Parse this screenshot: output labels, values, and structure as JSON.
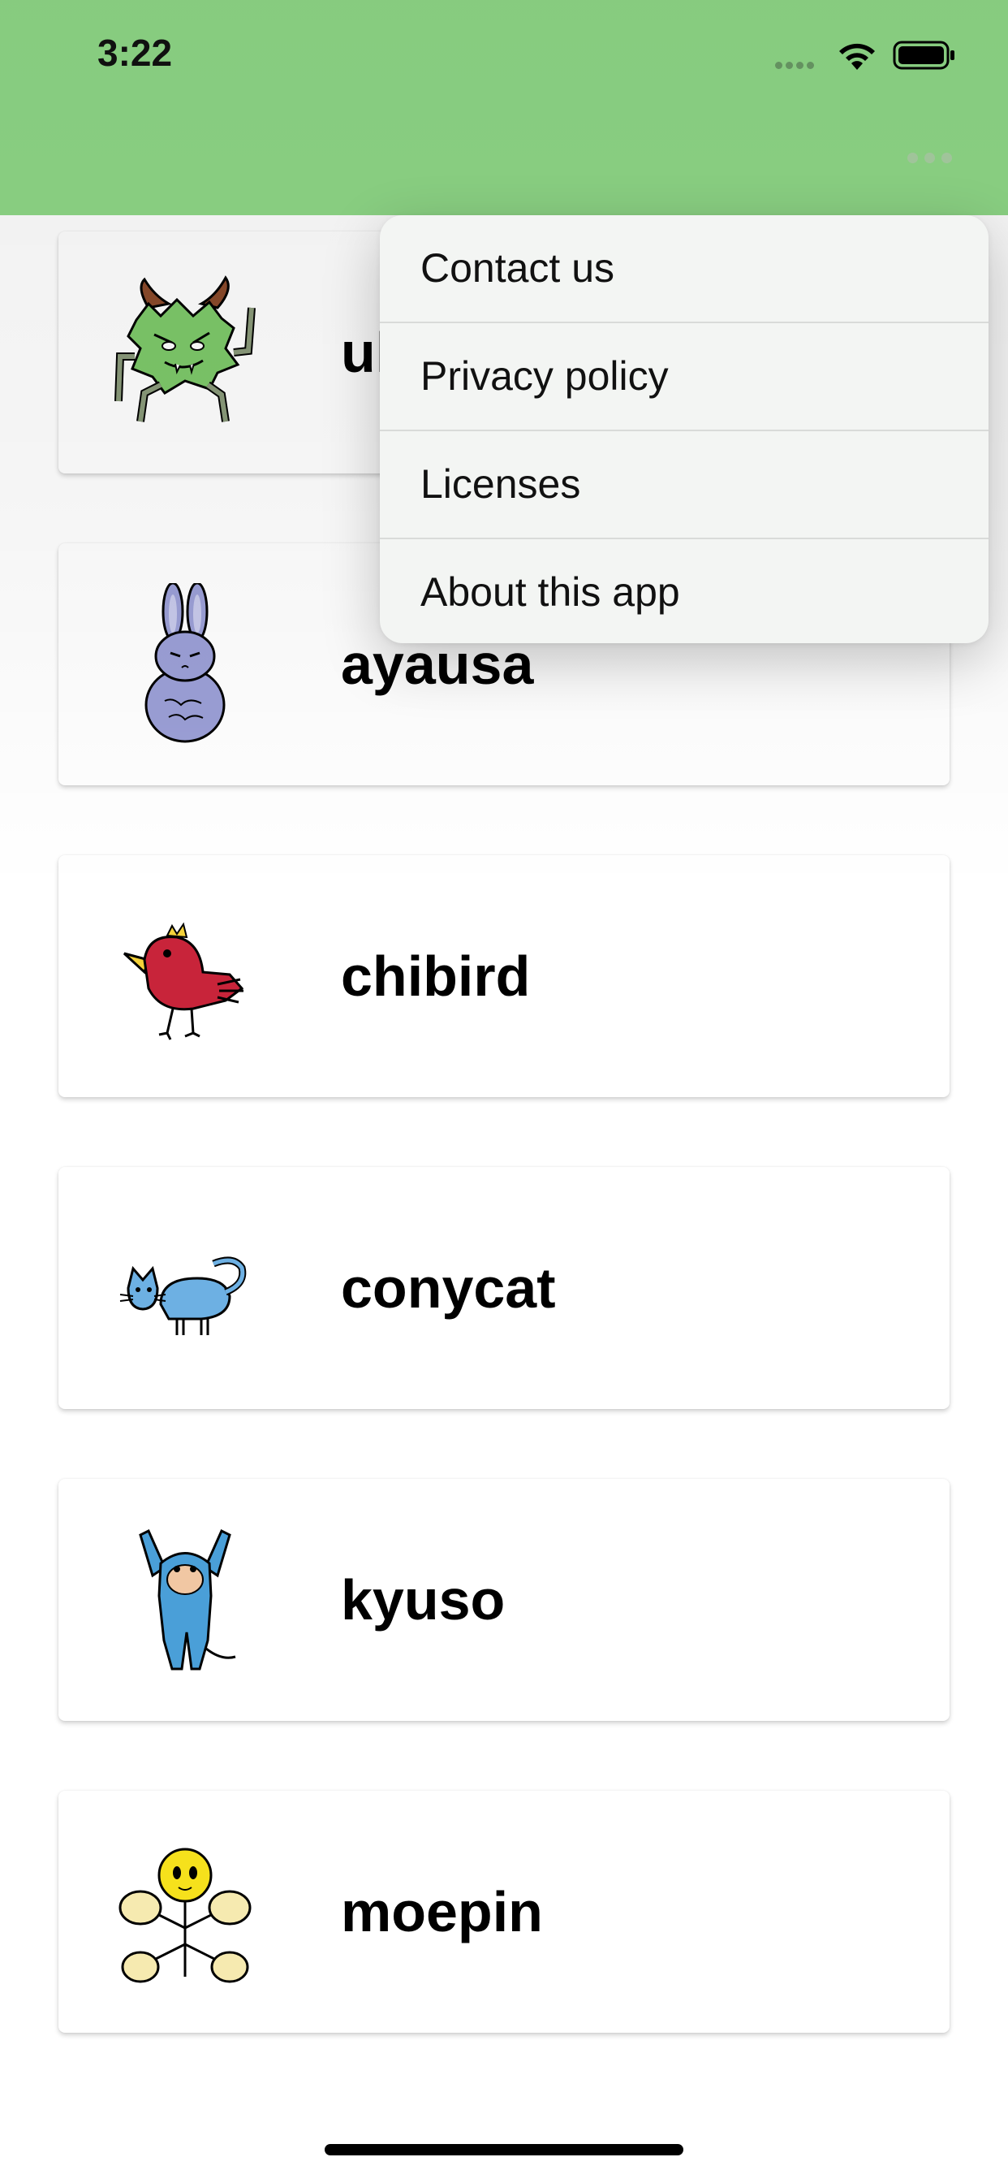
{
  "status_bar": {
    "time": "3:22"
  },
  "menu": {
    "items": [
      "Contact us",
      "Privacy policy",
      "Licenses",
      "About this app"
    ]
  },
  "characters": [
    "ukaikaiju",
    "ayausa",
    "chibird",
    "conycat",
    "kyuso",
    "moepin"
  ],
  "colors": {
    "header": "#8fd887",
    "menu_background": "#f3f5f3",
    "card_background": "#ffffff",
    "text": "#000000"
  },
  "icons": [
    "more-icon",
    "wifi-icon",
    "battery-icon",
    "signal-icon"
  ]
}
